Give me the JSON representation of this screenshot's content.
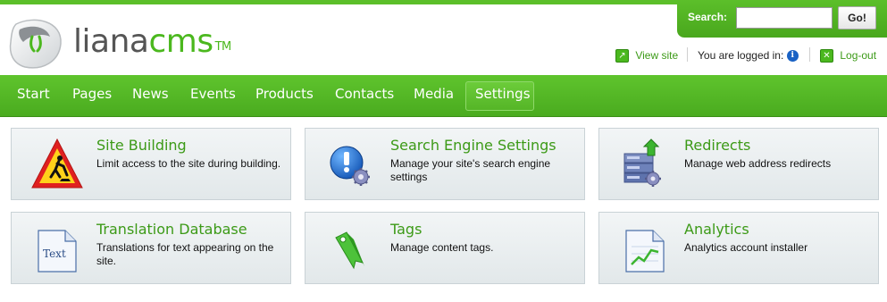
{
  "logo": {
    "brand_prefix": "liana",
    "brand_suffix": "cms",
    "trademark": "TM"
  },
  "search": {
    "label": "Search:",
    "value": "",
    "placeholder": "",
    "button_label": "Go!"
  },
  "userbar": {
    "view_site_label": "View site",
    "logged_in_label": "You are logged in:",
    "logout_label": "Log-out",
    "info_glyph": "i"
  },
  "nav": {
    "items": [
      {
        "label": "Start"
      },
      {
        "label": "Pages"
      },
      {
        "label": "News"
      },
      {
        "label": "Events"
      },
      {
        "label": "Products"
      },
      {
        "label": "Contacts"
      },
      {
        "label": "Media"
      },
      {
        "label": "Settings",
        "active": true
      }
    ]
  },
  "cards": [
    {
      "title": "Site Building",
      "description": "Limit access to the site during building.",
      "icon": "construction-sign-icon"
    },
    {
      "title": "Search Engine Settings",
      "description": "Manage your site's search engine settings",
      "icon": "search-engine-settings-icon"
    },
    {
      "title": "Redirects",
      "description": "Manage web address redirects",
      "icon": "redirects-server-icon"
    },
    {
      "title": "Translation Database",
      "description": "Translations for text appearing on the site.",
      "icon": "text-document-icon",
      "icon_text": "Text"
    },
    {
      "title": "Tags",
      "description": "Manage content tags.",
      "icon": "tag-ribbon-icon"
    },
    {
      "title": "Analytics",
      "description": "Analytics account installer",
      "icon": "analytics-chart-icon"
    }
  ],
  "colors": {
    "brand_green": "#4bb81e",
    "nav_green": "#55b527",
    "link_green": "#3c9a17"
  }
}
